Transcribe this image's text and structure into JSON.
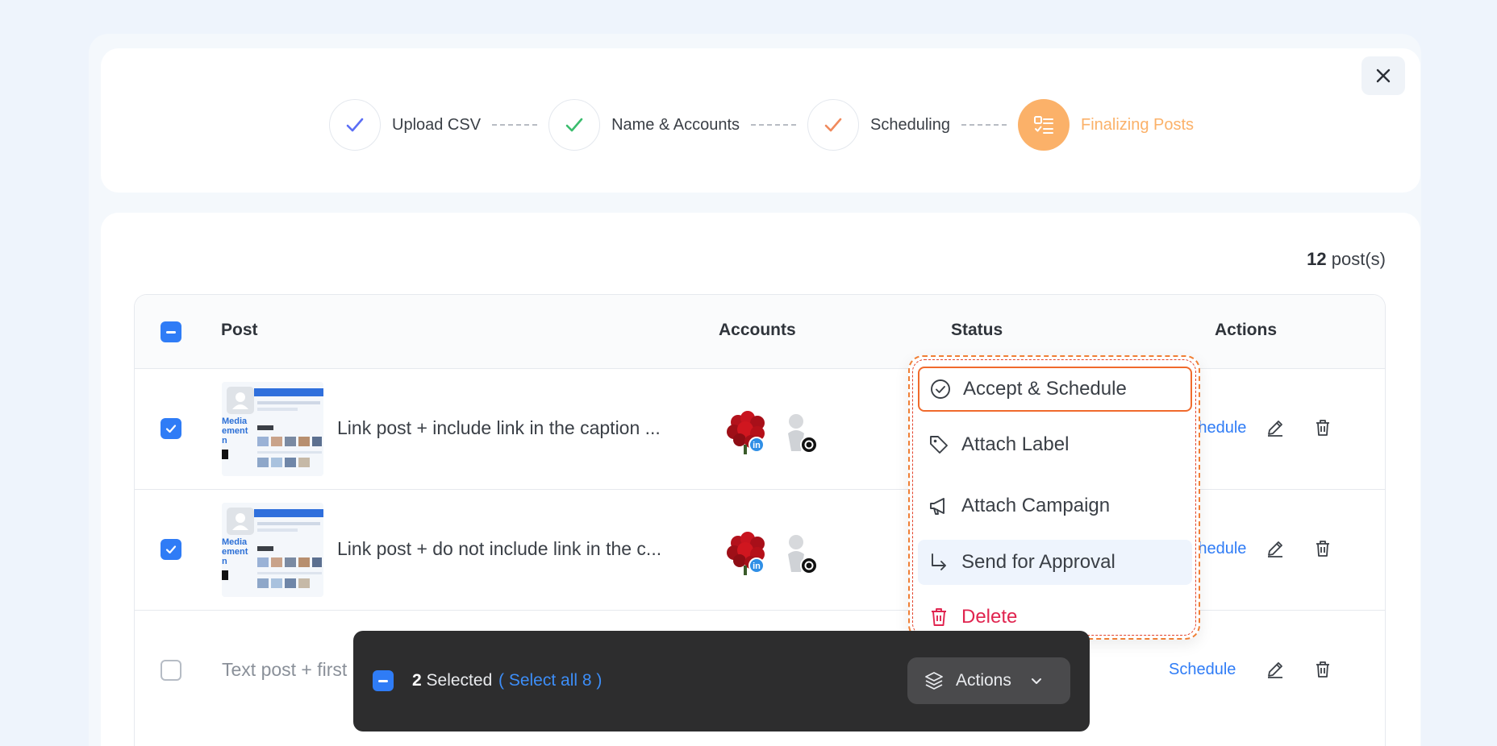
{
  "stepper": {
    "steps": [
      {
        "label": "Upload CSV",
        "state": "done",
        "check_color": "#5b6ef5"
      },
      {
        "label": "Name & Accounts",
        "state": "done",
        "check_color": "#3bbd6e"
      },
      {
        "label": "Scheduling",
        "state": "done",
        "check_color": "#f08a5d"
      },
      {
        "label": "Finalizing Posts",
        "state": "active",
        "accent": "#fbb169"
      }
    ]
  },
  "posts": {
    "count": "12",
    "count_suffix": " post(s)"
  },
  "table": {
    "headers": {
      "post": "Post",
      "accounts": "Accounts",
      "status": "Status",
      "actions": "Actions"
    },
    "rows": [
      {
        "text": "Link post + include link in the caption ...",
        "checked": true,
        "schedule": "Schedule",
        "thumb_text": "Media\nement\nn"
      },
      {
        "text": "Link post + do not include link in the c...",
        "checked": true,
        "schedule": "Schedule",
        "thumb_text": "Media\nement\nn"
      },
      {
        "text": "Text post + first",
        "checked": false,
        "schedule": "Schedule"
      }
    ],
    "badges": {
      "linkedin": "in"
    }
  },
  "menu": {
    "items": [
      {
        "label": "Accept & Schedule",
        "icon": "check-circle-icon"
      },
      {
        "label": "Attach Label",
        "icon": "tag-icon"
      },
      {
        "label": "Attach Campaign",
        "icon": "megaphone-icon"
      },
      {
        "label": "Send for Approval",
        "icon": "arrow-turn-icon"
      },
      {
        "label": "Delete",
        "icon": "trash-icon"
      }
    ]
  },
  "selection_bar": {
    "count": "2",
    "count_suffix": " Selected",
    "select_all": "( Select all 8 )",
    "actions_label": "Actions"
  },
  "colors": {
    "accent": "#2f7cf6",
    "brand_orange": "#fbb169",
    "danger": "#e0244f"
  }
}
